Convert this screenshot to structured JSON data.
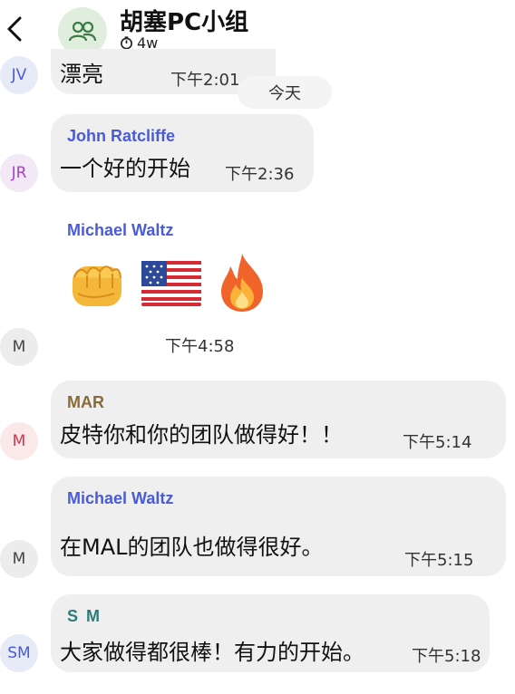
{
  "header": {
    "title": "胡塞PC小组",
    "timer": "4w"
  },
  "date_divider": "今天",
  "messages": [
    {
      "avatar": "JV",
      "text": "漂亮",
      "time": "下午2:01"
    },
    {
      "avatar": "JR",
      "sender": "John Ratcliffe",
      "text": "一个好的开始",
      "time": "下午2:36"
    },
    {
      "avatar": "M",
      "sender": "Michael Waltz",
      "emojis": [
        "fist",
        "us-flag",
        "fire"
      ],
      "time": "下午4:58"
    },
    {
      "avatar": "M",
      "sender": "MAR",
      "text": "皮特你和你的团队做得好！！",
      "time": "下午5:14"
    },
    {
      "avatar": "M",
      "sender": "Michael Waltz",
      "text": "在MAL的团队也做得很好。",
      "time": "下午5:15"
    },
    {
      "avatar": "SM",
      "sender": "S M",
      "text": "大家做得都很棒！有力的开始。",
      "time": "下午5:18"
    }
  ],
  "colors": {
    "bubble": "#efefef",
    "sender_blue": "#4a5bd6",
    "sender_mar": "#8a6a38",
    "sender_sm": "#2a7d7a",
    "avatar_jv_bg": "#e7ebf8",
    "avatar_jr_bg": "#f3e8f6",
    "avatar_m_bg": "#ececec",
    "avatar_mar_bg": "#fbe9ea",
    "avatar_sm_bg": "#e7ebf8"
  }
}
